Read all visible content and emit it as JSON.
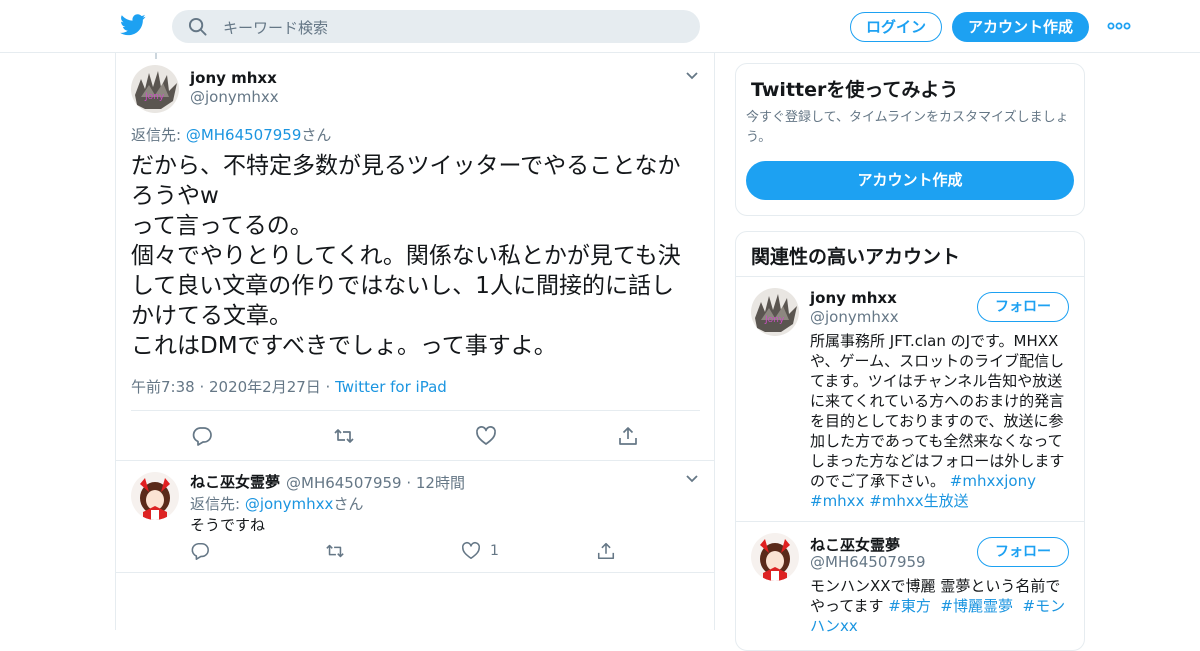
{
  "header": {
    "search_placeholder": "キーワード検索",
    "login_label": "ログイン",
    "signup_label": "アカウント作成",
    "brand_color": "#1da1f2"
  },
  "tweet": {
    "author_name": "jony mhxx",
    "author_handle": "@jonymhxx",
    "reply_prefix": "返信先: ",
    "reply_handle": "@MH64507959",
    "reply_suffix": "さん",
    "text": "だから、不特定多数が見るツイッターでやることなか\nろうやw\nって言ってるの。\n個々でやりとりしてくれ。関係ない私とかが見ても決\nして良い文章の作りではないし、1人に間接的に話し\nかけてる文章。\nこれはDMですべきでしょ。って事すよ。",
    "timestamp": "午前7:38 · 2020年2月27日 · ",
    "source": "Twitter for iPad"
  },
  "reply": {
    "author_name": "ねこ巫女霊夢",
    "author_handle": "@MH64507959",
    "time": " · 12時間",
    "reply_prefix": "返信先: ",
    "reply_handle": "@jonymhxx",
    "reply_suffix": "さん",
    "text": "そうですね",
    "like_count": "1"
  },
  "signup_card": {
    "title": "Twitterを使ってみよう",
    "subtitle": "今すぐ登録して、タイムラインをカスタマイズしましょう。",
    "button_label": "アカウント作成"
  },
  "related_card": {
    "title": "関連性の高いアカウント",
    "accounts": [
      {
        "name": "jony mhxx",
        "handle": "@jonymhxx",
        "follow_label": "フォロー",
        "bio": "所属事務所 JFT.clan のJです。MHXXや、ゲーム、スロットのライブ配信してます。ツイはチャンネル告知や放送に来てくれている方へのおまけ的発言を目的としておりますので、放送に参加した方であっても全然来なくなってしまった方などはフォローは外しますのでご了承下さい。 ",
        "tags": [
          "#mhxxjony",
          "#mhxx",
          "#mhxx生放送"
        ]
      },
      {
        "name": "ねこ巫女霊夢",
        "handle": "@MH64507959",
        "follow_label": "フォロー",
        "bio": "モンハンXXで博麗 霊夢という名前でやってます ",
        "tags": [
          "#東方",
          "#博麗霊夢",
          "#モンハンxx"
        ]
      }
    ]
  }
}
